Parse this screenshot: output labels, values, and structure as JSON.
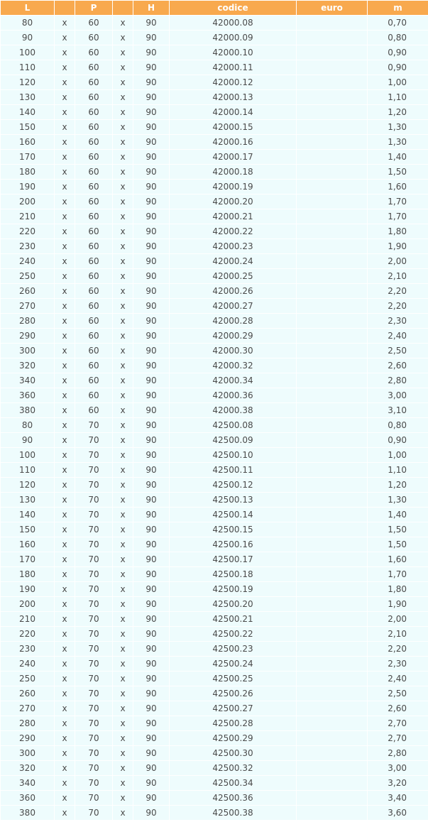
{
  "headers": {
    "l": "L",
    "x1": "",
    "p": "P",
    "x2": "",
    "h": "H",
    "codice": "codice",
    "euro": "euro",
    "m": "m"
  },
  "colors": {
    "header_bg": "#f8a94e",
    "cell_bg": "#eefcfd",
    "text": "#4a4a4a"
  },
  "rows": [
    {
      "l": "80",
      "x1": "x",
      "p": "60",
      "x2": "x",
      "h": "90",
      "codice": "42000.08",
      "euro": "",
      "m": "0,70"
    },
    {
      "l": "90",
      "x1": "x",
      "p": "60",
      "x2": "x",
      "h": "90",
      "codice": "42000.09",
      "euro": "",
      "m": "0,80"
    },
    {
      "l": "100",
      "x1": "x",
      "p": "60",
      "x2": "x",
      "h": "90",
      "codice": "42000.10",
      "euro": "",
      "m": "0,90"
    },
    {
      "l": "110",
      "x1": "x",
      "p": "60",
      "x2": "x",
      "h": "90",
      "codice": "42000.11",
      "euro": "",
      "m": "0,90"
    },
    {
      "l": "120",
      "x1": "x",
      "p": "60",
      "x2": "x",
      "h": "90",
      "codice": "42000.12",
      "euro": "",
      "m": "1,00"
    },
    {
      "l": "130",
      "x1": "x",
      "p": "60",
      "x2": "x",
      "h": "90",
      "codice": "42000.13",
      "euro": "",
      "m": "1,10"
    },
    {
      "l": "140",
      "x1": "x",
      "p": "60",
      "x2": "x",
      "h": "90",
      "codice": "42000.14",
      "euro": "",
      "m": "1,20"
    },
    {
      "l": "150",
      "x1": "x",
      "p": "60",
      "x2": "x",
      "h": "90",
      "codice": "42000.15",
      "euro": "",
      "m": "1,30"
    },
    {
      "l": "160",
      "x1": "x",
      "p": "60",
      "x2": "x",
      "h": "90",
      "codice": "42000.16",
      "euro": "",
      "m": "1,30"
    },
    {
      "l": "170",
      "x1": "x",
      "p": "60",
      "x2": "x",
      "h": "90",
      "codice": "42000.17",
      "euro": "",
      "m": "1,40"
    },
    {
      "l": "180",
      "x1": "x",
      "p": "60",
      "x2": "x",
      "h": "90",
      "codice": "42000.18",
      "euro": "",
      "m": "1,50"
    },
    {
      "l": "190",
      "x1": "x",
      "p": "60",
      "x2": "x",
      "h": "90",
      "codice": "42000.19",
      "euro": "",
      "m": "1,60"
    },
    {
      "l": "200",
      "x1": "x",
      "p": "60",
      "x2": "x",
      "h": "90",
      "codice": "42000.20",
      "euro": "",
      "m": "1,70"
    },
    {
      "l": "210",
      "x1": "x",
      "p": "60",
      "x2": "x",
      "h": "90",
      "codice": "42000.21",
      "euro": "",
      "m": "1,70"
    },
    {
      "l": "220",
      "x1": "x",
      "p": "60",
      "x2": "x",
      "h": "90",
      "codice": "42000.22",
      "euro": "",
      "m": "1,80"
    },
    {
      "l": "230",
      "x1": "x",
      "p": "60",
      "x2": "x",
      "h": "90",
      "codice": "42000.23",
      "euro": "",
      "m": "1,90"
    },
    {
      "l": "240",
      "x1": "x",
      "p": "60",
      "x2": "x",
      "h": "90",
      "codice": "42000.24",
      "euro": "",
      "m": "2,00"
    },
    {
      "l": "250",
      "x1": "x",
      "p": "60",
      "x2": "x",
      "h": "90",
      "codice": "42000.25",
      "euro": "",
      "m": "2,10"
    },
    {
      "l": "260",
      "x1": "x",
      "p": "60",
      "x2": "x",
      "h": "90",
      "codice": "42000.26",
      "euro": "",
      "m": "2,20"
    },
    {
      "l": "270",
      "x1": "x",
      "p": "60",
      "x2": "x",
      "h": "90",
      "codice": "42000.27",
      "euro": "",
      "m": "2,20"
    },
    {
      "l": "280",
      "x1": "x",
      "p": "60",
      "x2": "x",
      "h": "90",
      "codice": "42000.28",
      "euro": "",
      "m": "2,30"
    },
    {
      "l": "290",
      "x1": "x",
      "p": "60",
      "x2": "x",
      "h": "90",
      "codice": "42000.29",
      "euro": "",
      "m": "2,40"
    },
    {
      "l": "300",
      "x1": "x",
      "p": "60",
      "x2": "x",
      "h": "90",
      "codice": "42000.30",
      "euro": "",
      "m": "2,50"
    },
    {
      "l": "320",
      "x1": "x",
      "p": "60",
      "x2": "x",
      "h": "90",
      "codice": "42000.32",
      "euro": "",
      "m": "2,60"
    },
    {
      "l": "340",
      "x1": "x",
      "p": "60",
      "x2": "x",
      "h": "90",
      "codice": "42000.34",
      "euro": "",
      "m": "2,80"
    },
    {
      "l": "360",
      "x1": "x",
      "p": "60",
      "x2": "x",
      "h": "90",
      "codice": "42000.36",
      "euro": "",
      "m": "3,00"
    },
    {
      "l": "380",
      "x1": "x",
      "p": "60",
      "x2": "x",
      "h": "90",
      "codice": "42000.38",
      "euro": "",
      "m": "3,10"
    },
    {
      "l": "80",
      "x1": "x",
      "p": "70",
      "x2": "x",
      "h": "90",
      "codice": "42500.08",
      "euro": "",
      "m": "0,80"
    },
    {
      "l": "90",
      "x1": "x",
      "p": "70",
      "x2": "x",
      "h": "90",
      "codice": "42500.09",
      "euro": "",
      "m": "0,90"
    },
    {
      "l": "100",
      "x1": "x",
      "p": "70",
      "x2": "x",
      "h": "90",
      "codice": "42500.10",
      "euro": "",
      "m": "1,00"
    },
    {
      "l": "110",
      "x1": "x",
      "p": "70",
      "x2": "x",
      "h": "90",
      "codice": "42500.11",
      "euro": "",
      "m": "1,10"
    },
    {
      "l": "120",
      "x1": "x",
      "p": "70",
      "x2": "x",
      "h": "90",
      "codice": "42500.12",
      "euro": "",
      "m": "1,20"
    },
    {
      "l": "130",
      "x1": "x",
      "p": "70",
      "x2": "x",
      "h": "90",
      "codice": "42500.13",
      "euro": "",
      "m": "1,30"
    },
    {
      "l": "140",
      "x1": "x",
      "p": "70",
      "x2": "x",
      "h": "90",
      "codice": "42500.14",
      "euro": "",
      "m": "1,40"
    },
    {
      "l": "150",
      "x1": "x",
      "p": "70",
      "x2": "x",
      "h": "90",
      "codice": "42500.15",
      "euro": "",
      "m": "1,50"
    },
    {
      "l": "160",
      "x1": "x",
      "p": "70",
      "x2": "x",
      "h": "90",
      "codice": "42500.16",
      "euro": "",
      "m": "1,50"
    },
    {
      "l": "170",
      "x1": "x",
      "p": "70",
      "x2": "x",
      "h": "90",
      "codice": "42500.17",
      "euro": "",
      "m": "1,60"
    },
    {
      "l": "180",
      "x1": "x",
      "p": "70",
      "x2": "x",
      "h": "90",
      "codice": "42500.18",
      "euro": "",
      "m": "1,70"
    },
    {
      "l": "190",
      "x1": "x",
      "p": "70",
      "x2": "x",
      "h": "90",
      "codice": "42500.19",
      "euro": "",
      "m": "1,80"
    },
    {
      "l": "200",
      "x1": "x",
      "p": "70",
      "x2": "x",
      "h": "90",
      "codice": "42500.20",
      "euro": "",
      "m": "1,90"
    },
    {
      "l": "210",
      "x1": "x",
      "p": "70",
      "x2": "x",
      "h": "90",
      "codice": "42500.21",
      "euro": "",
      "m": "2,00"
    },
    {
      "l": "220",
      "x1": "x",
      "p": "70",
      "x2": "x",
      "h": "90",
      "codice": "42500.22",
      "euro": "",
      "m": "2,10"
    },
    {
      "l": "230",
      "x1": "x",
      "p": "70",
      "x2": "x",
      "h": "90",
      "codice": "42500.23",
      "euro": "",
      "m": "2,20"
    },
    {
      "l": "240",
      "x1": "x",
      "p": "70",
      "x2": "x",
      "h": "90",
      "codice": "42500.24",
      "euro": "",
      "m": "2,30"
    },
    {
      "l": "250",
      "x1": "x",
      "p": "70",
      "x2": "x",
      "h": "90",
      "codice": "42500.25",
      "euro": "",
      "m": "2,40"
    },
    {
      "l": "260",
      "x1": "x",
      "p": "70",
      "x2": "x",
      "h": "90",
      "codice": "42500.26",
      "euro": "",
      "m": "2,50"
    },
    {
      "l": "270",
      "x1": "x",
      "p": "70",
      "x2": "x",
      "h": "90",
      "codice": "42500.27",
      "euro": "",
      "m": "2,60"
    },
    {
      "l": "280",
      "x1": "x",
      "p": "70",
      "x2": "x",
      "h": "90",
      "codice": "42500.28",
      "euro": "",
      "m": "2,70"
    },
    {
      "l": "290",
      "x1": "x",
      "p": "70",
      "x2": "x",
      "h": "90",
      "codice": "42500.29",
      "euro": "",
      "m": "2,70"
    },
    {
      "l": "300",
      "x1": "x",
      "p": "70",
      "x2": "x",
      "h": "90",
      "codice": "42500.30",
      "euro": "",
      "m": "2,80"
    },
    {
      "l": "320",
      "x1": "x",
      "p": "70",
      "x2": "x",
      "h": "90",
      "codice": "42500.32",
      "euro": "",
      "m": "3,00"
    },
    {
      "l": "340",
      "x1": "x",
      "p": "70",
      "x2": "x",
      "h": "90",
      "codice": "42500.34",
      "euro": "",
      "m": "3,20"
    },
    {
      "l": "360",
      "x1": "x",
      "p": "70",
      "x2": "x",
      "h": "90",
      "codice": "42500.36",
      "euro": "",
      "m": "3,40"
    },
    {
      "l": "380",
      "x1": "x",
      "p": "70",
      "x2": "x",
      "h": "90",
      "codice": "42500.38",
      "euro": "",
      "m": "3,60"
    }
  ]
}
